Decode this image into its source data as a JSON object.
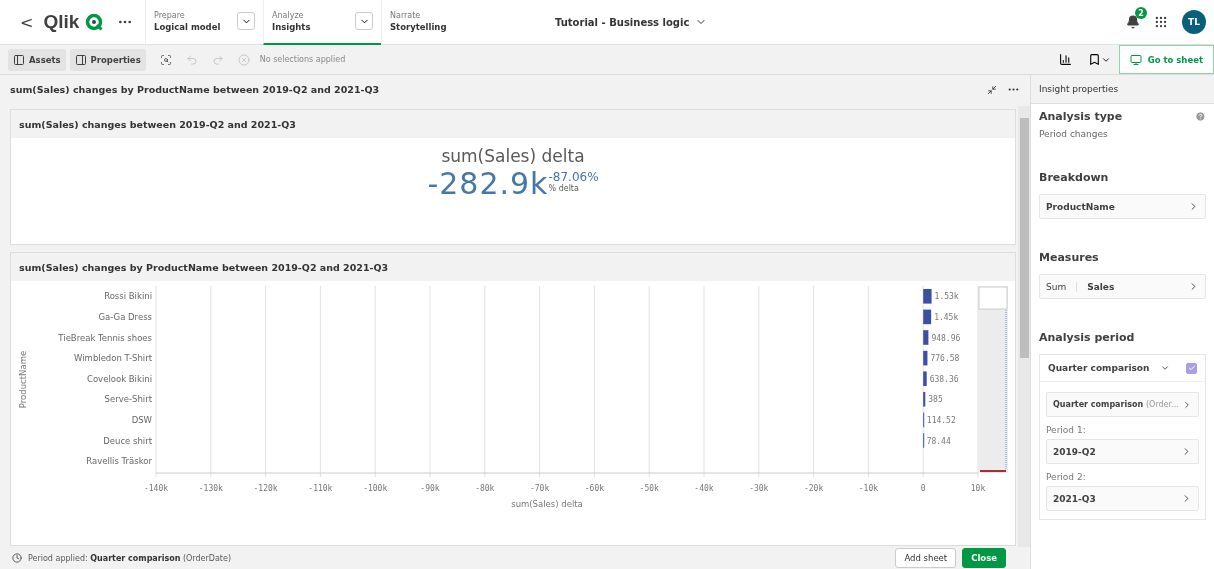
{
  "header": {
    "back": "<",
    "logo_text": "Qlik",
    "nav_tabs": [
      {
        "section": "Prepare",
        "label": "Logical model",
        "selected": false,
        "dropdown": true
      },
      {
        "section": "Analyze",
        "label": "Insights",
        "selected": true,
        "dropdown": true
      },
      {
        "section": "Narrate",
        "label": "Storytelling",
        "selected": false,
        "dropdown": false
      }
    ],
    "app_title": "Tutorial - Business logic",
    "notification_count": "2",
    "avatar_initials": "TL"
  },
  "toolbar": {
    "buttons": [
      {
        "kind": "assets",
        "label": "Assets"
      },
      {
        "kind": "properties",
        "label": "Properties"
      }
    ],
    "tools": [
      {
        "kind": "search",
        "disabled": false
      },
      {
        "kind": "back",
        "disabled": true
      },
      {
        "kind": "forward",
        "disabled": true
      },
      {
        "kind": "clear",
        "disabled": true
      }
    ],
    "selections_status": "No selections applied",
    "go_to_sheet": "Go to sheet"
  },
  "insight": {
    "title": "sum(Sales) changes by ProductName between 2019-Q2 and 2021-Q3",
    "kpi_card": {
      "title": "sum(Sales) changes between 2019-Q2 and 2021-Q3",
      "measure_label": "sum(Sales) delta",
      "value": "-282.9k",
      "percent": "-87.06%",
      "percent_label": "% delta"
    },
    "chart_card": {
      "title": "sum(Sales) changes by ProductName between 2019-Q2 and 2021-Q3",
      "chart_data": {
        "type": "bar",
        "orientation": "horizontal",
        "xlabel": "sum(Sales) delta",
        "ylabel": "ProductName",
        "categories": [
          "Rossi Bikini",
          "Ga-Ga Dress",
          "TieBreak Tennis shoes",
          "Wimbledon T-Shirt",
          "Covelook Bikini",
          "Serve-Shirt",
          "DSW",
          "Deuce shirt",
          "Ravellis Träskor"
        ],
        "values": [
          1530,
          1450,
          948.96,
          776.58,
          638.36,
          385,
          114.52,
          78.44,
          null
        ],
        "grid": true,
        "value_labels": [
          "1.53k",
          "1.45k",
          "948.96",
          "776.58",
          "638.36",
          "385",
          "114.52",
          "78.44",
          null
        ],
        "xlim": [
          -140000,
          10000
        ],
        "xticks": [
          {
            "value": -140000,
            "label": "-140k"
          },
          {
            "value": -130000,
            "label": "-130k"
          },
          {
            "value": -120000,
            "label": "-120k"
          },
          {
            "value": -110000,
            "label": "-110k"
          },
          {
            "value": -100000,
            "label": "-100k"
          },
          {
            "value": -90000,
            "label": "-90k"
          },
          {
            "value": -80000,
            "label": "-80k"
          },
          {
            "value": -70000,
            "label": "-70k"
          },
          {
            "value": -60000,
            "label": "-60k"
          },
          {
            "value": -50000,
            "label": "-50k"
          },
          {
            "value": -40000,
            "label": "-40k"
          },
          {
            "value": -30000,
            "label": "-30k"
          },
          {
            "value": -20000,
            "label": "-20k"
          },
          {
            "value": -10000,
            "label": "-10k"
          },
          {
            "value": 0,
            "label": "0"
          },
          {
            "value": 10000,
            "label": "10k"
          }
        ]
      }
    },
    "footer": {
      "text": "Period applied: **Quarter comparison** (OrderDate)",
      "buttons": [
        {
          "kind": "secondary",
          "label": "Add sheet"
        },
        {
          "kind": "primary",
          "label": "Close"
        }
      ]
    }
  },
  "properties": {
    "title": "Insight properties",
    "analysis_type": {
      "heading": "Analysis type",
      "value": "Period changes"
    },
    "breakdown": {
      "heading": "Breakdown",
      "field": "ProductName"
    },
    "measures": {
      "heading": "Measures",
      "aggregation": "Sum",
      "field": "Sales"
    },
    "analysis_period": {
      "heading": "Analysis period",
      "name": "Quarter comparison",
      "checked": true,
      "expanded": true,
      "period_field": "Quarter comparison",
      "period_field_hint": "(Order...",
      "periods": [
        {
          "label": "Period 1:",
          "value": "2019-Q2"
        },
        {
          "label": "Period 2:",
          "value": "2021-Q3"
        }
      ]
    }
  }
}
